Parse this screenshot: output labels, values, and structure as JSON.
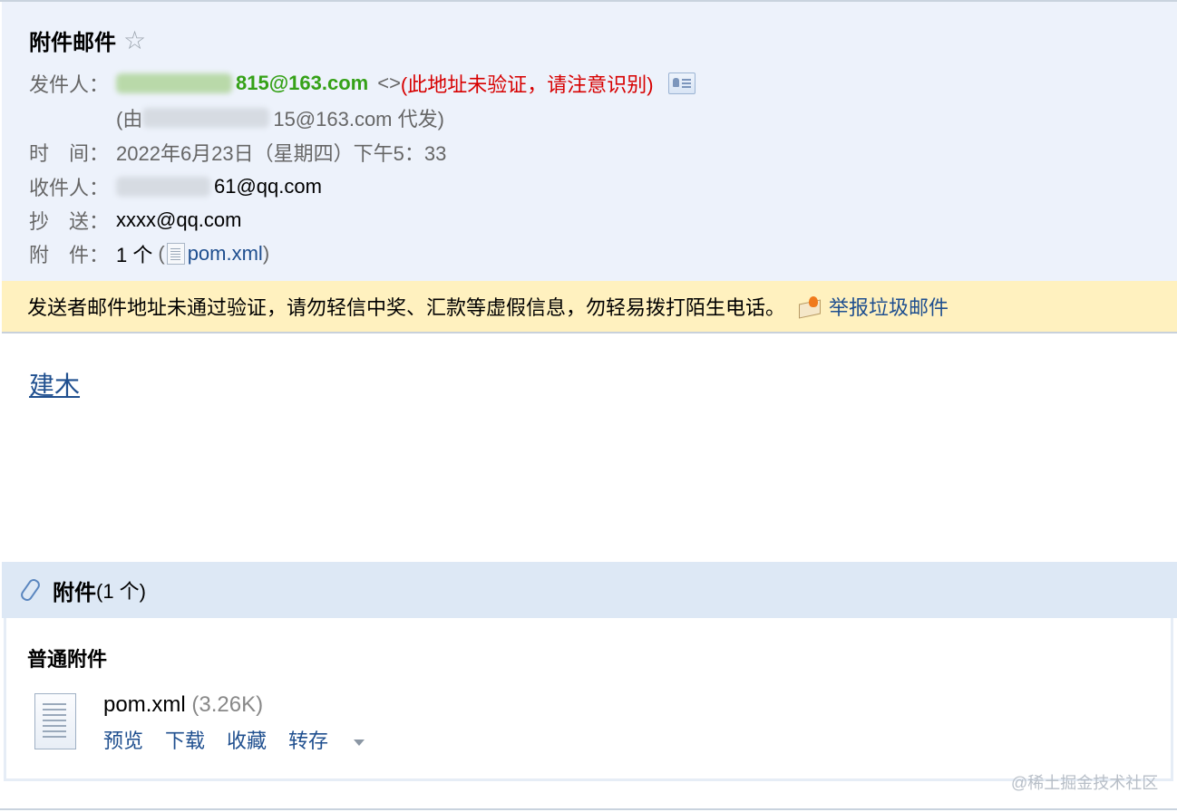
{
  "email": {
    "subject": "附件邮件",
    "sender": {
      "label": "发件人：",
      "email_visible": "815@163.com",
      "brackets": "<>",
      "warning": "(此地址未验证，请注意识别)",
      "proxy_prefix": "(由",
      "proxy_email_visible": "15@163.com 代发)"
    },
    "time": {
      "label": "时　间：",
      "value": "2022年6月23日（星期四）下午5：33"
    },
    "to": {
      "label": "收件人：",
      "value_visible": "61@qq.com"
    },
    "cc": {
      "label": "抄　送：",
      "value": "xxxx@qq.com"
    },
    "attachments_row": {
      "label": "附　件：",
      "count": "1 个",
      "open": "(",
      "file": "pom.xml",
      "close": ")"
    }
  },
  "warning_bar": {
    "text": "发送者邮件地址未通过验证，请勿轻信中奖、汇款等虚假信息，勿轻易拨打陌生电话。",
    "report_label": "举报垃圾邮件"
  },
  "body": {
    "link_text": "建木"
  },
  "attachments": {
    "title": "附件",
    "count": "(1 个)",
    "section": "普通附件",
    "file": {
      "name": "pom.xml",
      "size": "(3.26K)",
      "actions": [
        "预览",
        "下载",
        "收藏",
        "转存"
      ]
    }
  },
  "watermark": "@稀土掘金技术社区",
  "colors": {
    "header_bg": "#edf2fb",
    "warning_bg": "#fff1bf",
    "link": "#1f4f8f",
    "sender_green": "#35a117",
    "warning_red": "#d70000"
  }
}
